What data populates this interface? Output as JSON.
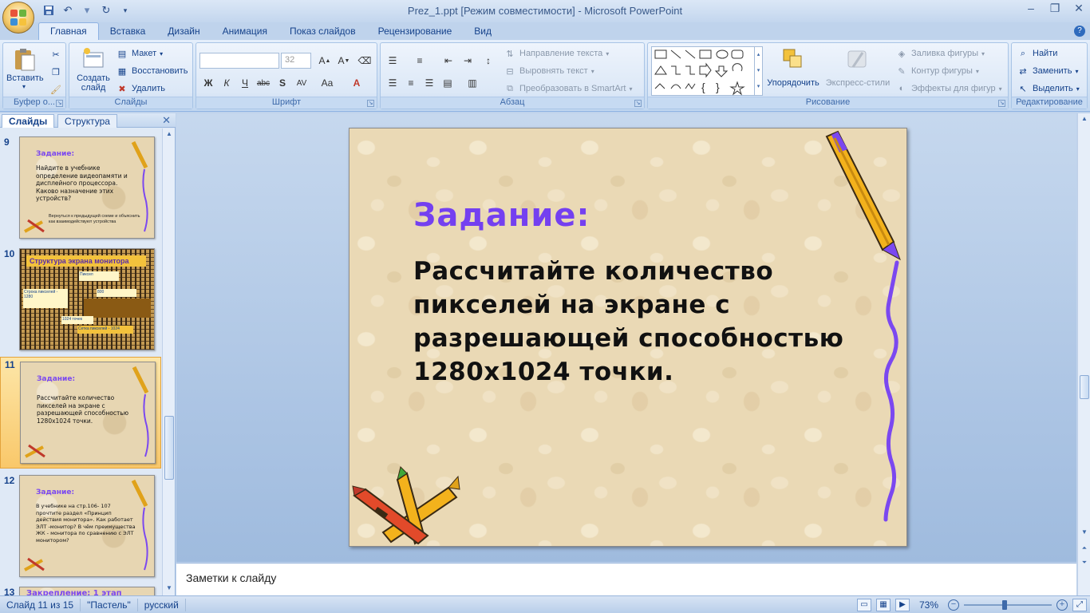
{
  "window": {
    "title": "Prez_1.ppt [Режим совместимости] - Microsoft PowerPoint"
  },
  "tabs": [
    "Главная",
    "Вставка",
    "Дизайн",
    "Анимация",
    "Показ слайдов",
    "Рецензирование",
    "Вид"
  ],
  "ribbon": {
    "clipboard": {
      "paste": "Вставить",
      "label": "Буфер о..."
    },
    "slides": {
      "new_slide": "Создать слайд",
      "layout": "Макет",
      "reset": "Восстановить",
      "delete": "Удалить",
      "label": "Слайды"
    },
    "font": {
      "size": "32",
      "label": "Шрифт"
    },
    "paragraph": {
      "text_direction": "Направление текста",
      "align_text": "Выровнять текст",
      "smartart": "Преобразовать в SmartArt",
      "label": "Абзац"
    },
    "drawing": {
      "arrange": "Упорядочить",
      "quick_styles": "Экспресс-стили",
      "shape_fill": "Заливка фигуры",
      "shape_outline": "Контур фигуры",
      "shape_effects": "Эффекты для фигур",
      "label": "Рисование"
    },
    "editing": {
      "find": "Найти",
      "replace": "Заменить",
      "select": "Выделить",
      "label": "Редактирование"
    }
  },
  "left_pane": {
    "tab_slides": "Слайды",
    "tab_outline": "Структура",
    "thumbnails": [
      {
        "num": "9",
        "title": "Задание:",
        "body": "Найдите в учебнике определение видеопамяти и дисплейного процессора. Каково назначение этих устройств?",
        "note": "Вернуться к предыдущей схеме и объяснить как взаимодействуют устройства"
      },
      {
        "num": "10",
        "title": "Структура экрана монитора",
        "labels": [
          "Пиксел",
          "Строка пикселей - 1280",
          "Сетка пикселей - 1024",
          "800",
          "1024 точек"
        ]
      },
      {
        "num": "11",
        "title": "Задание:",
        "body": "Рассчитайте количество пикселей на экране с разрешающей способностью 1280x1024 точки."
      },
      {
        "num": "12",
        "title": "Задание:",
        "body": "В учебнике на стр.106- 107 прочтите раздел «Принцип действия монитора». Как работает ЭЛТ -монитор? В чём преимущества ЖК - монитора по сравнению с ЭЛТ монитором?"
      },
      {
        "num": "13",
        "title": "Закрепление: 1 этап"
      }
    ]
  },
  "slide": {
    "title": "Задание:",
    "body": "Рассчитайте количество пикселей на экране с разрешающей способностью 1280x1024 точки."
  },
  "notes_placeholder": "Заметки к слайду",
  "status": {
    "slide_info": "Слайд 11 из 15",
    "theme": "\"Пастель\"",
    "language": "русский",
    "zoom": "73%"
  }
}
